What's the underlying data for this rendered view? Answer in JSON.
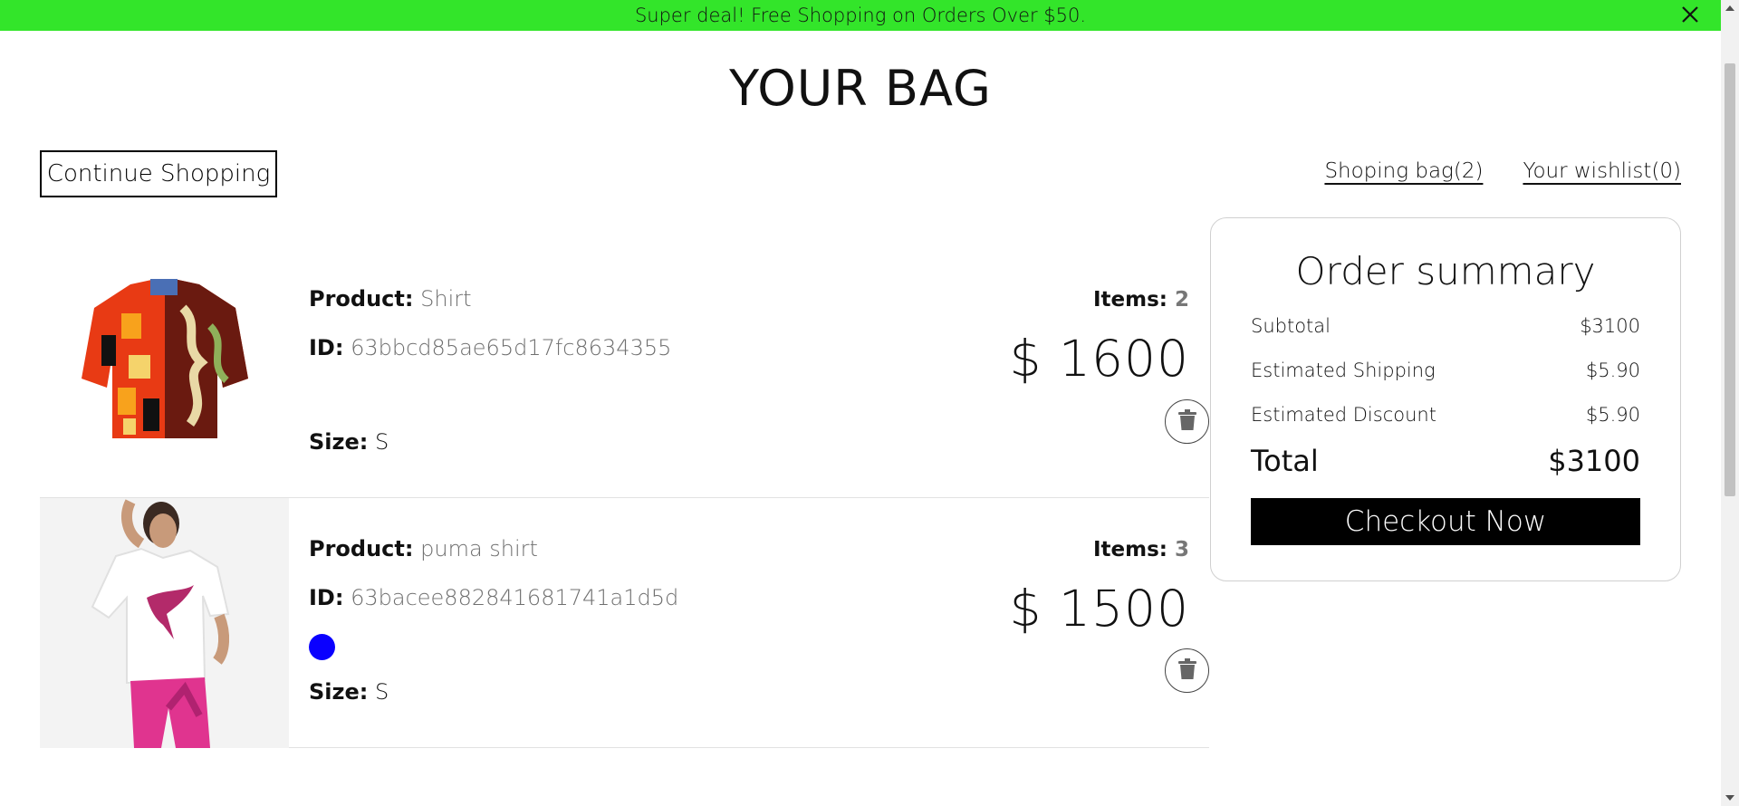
{
  "announcement": {
    "text": "Super deal! Free Shopping on Orders Over $50.",
    "background": "#33e52a"
  },
  "page": {
    "title": "YOUR BAG"
  },
  "nav": {
    "continue_label": "Continue Shopping",
    "bag_link": "Shoping bag(2)",
    "wishlist_link": "Your wishlist(0)"
  },
  "labels": {
    "product": "Product:",
    "id": "ID:",
    "size": "Size:",
    "items": "Items:"
  },
  "cart": {
    "items": [
      {
        "product": "Shirt",
        "id": "63bbcd85ae65d17fc8634355",
        "size": "S",
        "quantity": "2",
        "price": "$ 1600",
        "image": "shirt-image"
      },
      {
        "product": "puma shirt",
        "id": "63bacee882841681741a1d5d",
        "size": "S",
        "quantity": "3",
        "price": "$ 1500",
        "color": "#0a00ff",
        "image": "puma-shirt-image"
      }
    ]
  },
  "summary": {
    "title": "Order summary",
    "subtotal_label": "Subtotal",
    "subtotal": "$3100",
    "shipping_label": "Estimated Shipping",
    "shipping": "$5.90",
    "discount_label": "Estimated Discount",
    "discount": "$5.90",
    "total_label": "Total",
    "total": "$3100",
    "checkout_label": "Checkout Now"
  },
  "icons": {
    "close": "close-icon",
    "trash": "trash-icon"
  }
}
